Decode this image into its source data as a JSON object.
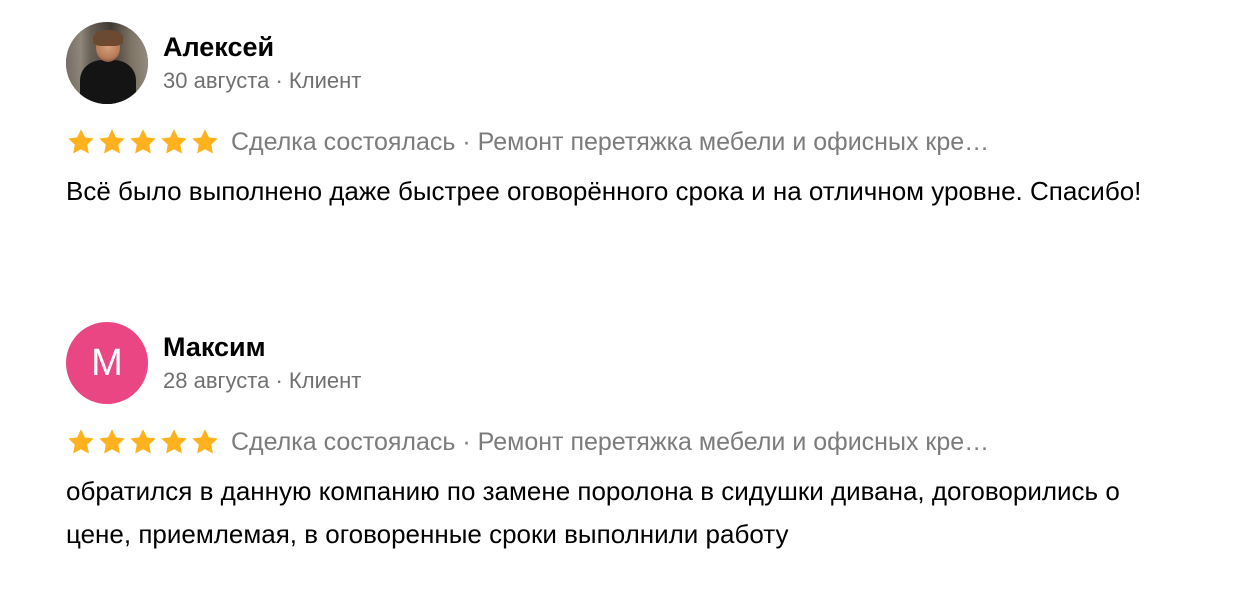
{
  "reviews": [
    {
      "author": "Алексей",
      "avatar_type": "photo",
      "date": "30 августа",
      "role": "Клиент",
      "rating": 5,
      "deal_text": "Сделка состоялась · Ремонт перетяжка мебели и офисных кре…",
      "text": "Всё было выполнено даже быстрее оговорённого срока и на отличном уровне. Спасибо!"
    },
    {
      "author": "Максим",
      "avatar_type": "letter",
      "avatar_letter": "М",
      "avatar_color": "#ea4683",
      "date": "28 августа",
      "role": "Клиент",
      "rating": 5,
      "deal_text": "Сделка состоялась · Ремонт перетяжка мебели и офисных кре…",
      "text": "обратился в данную компанию по замене поролона в сидушки дивана, договорились о цене, приемлемая, в оговоренные сроки выполнили работу"
    }
  ],
  "meta_separator": " · ",
  "star_icon": "star-icon",
  "star_color": "#ffb21e"
}
